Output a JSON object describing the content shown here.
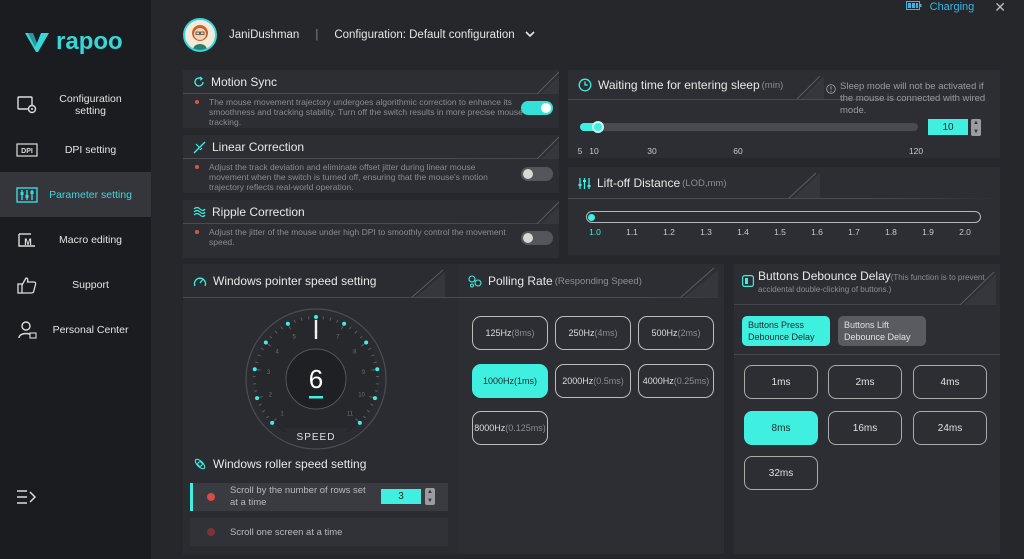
{
  "app": {
    "brand": "rapoo",
    "status": "Charging",
    "accent": "#3ff0e0"
  },
  "sidebar": {
    "items": [
      {
        "label": "Configuration setting",
        "icon": "configuration-icon"
      },
      {
        "label": "DPI setting",
        "icon": "dpi-icon"
      },
      {
        "label": "Parameter setting",
        "icon": "parameter-icon",
        "active": true
      },
      {
        "label": "Macro editing",
        "icon": "macro-icon"
      },
      {
        "label": "Support",
        "icon": "thumbs-up-icon"
      },
      {
        "label": "Personal Center",
        "icon": "person-icon"
      }
    ]
  },
  "header": {
    "username": "JaniDushman",
    "separator": "|",
    "configuration": "Configuration: Default configuration"
  },
  "motion_sync": {
    "title": "Motion Sync",
    "desc": "The mouse movement trajectory undergoes algorithmic correction to enhance its smoothness and tracking stability. Turn off the switch results in more precise mouse tracking.",
    "enabled": true
  },
  "linear_correction": {
    "title": "Linear Correction",
    "desc": "Adjust the track deviation and eliminate offset jitter during linear mouse movement when the switch is turned off, ensuring that the mouse's motion trajectory reflects real-world operation.",
    "enabled": false
  },
  "ripple_correction": {
    "title": "Ripple Correction",
    "desc": "Adjust the jitter of the mouse under high DPI to smoothly control the movement speed.",
    "enabled": false
  },
  "sleep": {
    "title": "Waiting time for entering sleep",
    "unit": "(min)",
    "note": "Sleep mode will not be activated if the mouse is connected with wired mode.",
    "value": "10",
    "ticks": [
      "5",
      "10",
      "30",
      "60",
      "120"
    ],
    "tick_values": [
      5,
      10,
      30,
      60,
      120
    ],
    "current": 10
  },
  "lod": {
    "title": "Lift-off Distance",
    "unit": "(LOD,mm)",
    "ticks": [
      "1.0",
      "1.1",
      "1.2",
      "1.3",
      "1.4",
      "1.5",
      "1.6",
      "1.7",
      "1.8",
      "1.9",
      "2.0"
    ],
    "current": 1.0
  },
  "pointer_speed": {
    "title": "Windows pointer speed setting",
    "value": "6",
    "label": "SPEED",
    "gauge_labels": [
      "1",
      "2",
      "3",
      "4",
      "5",
      "6",
      "7",
      "8",
      "9",
      "10",
      "11"
    ]
  },
  "roller_speed": {
    "title": "Windows roller speed setting",
    "option1": "Scroll by the number of rows set at a time",
    "option1_value": "3",
    "option2": "Scroll one screen at a time"
  },
  "polling": {
    "title": "Polling Rate",
    "sub": "(Responding Speed)",
    "options": [
      {
        "hz": "125Hz",
        "ms": "(8ms)"
      },
      {
        "hz": "250Hz",
        "ms": "(4ms)"
      },
      {
        "hz": "500Hz",
        "ms": "(2ms)"
      },
      {
        "hz": "1000Hz",
        "ms": "(1ms)",
        "selected": true
      },
      {
        "hz": "2000Hz",
        "ms": "(0.5ms)"
      },
      {
        "hz": "4000Hz",
        "ms": "(0.25ms)"
      },
      {
        "hz": "8000Hz",
        "ms": "(0.125ms)"
      }
    ]
  },
  "debounce": {
    "title": "Buttons Debounce Delay",
    "sub": "(This function is to prevent accidental double-clicking of buttons.)",
    "tab_press": "Buttons Press Debounce Delay",
    "tab_lift": "Buttons Lift Debounce Delay",
    "options": [
      "1ms",
      "2ms",
      "4ms",
      "8ms",
      "16ms",
      "24ms",
      "32ms"
    ],
    "selected": "8ms"
  }
}
